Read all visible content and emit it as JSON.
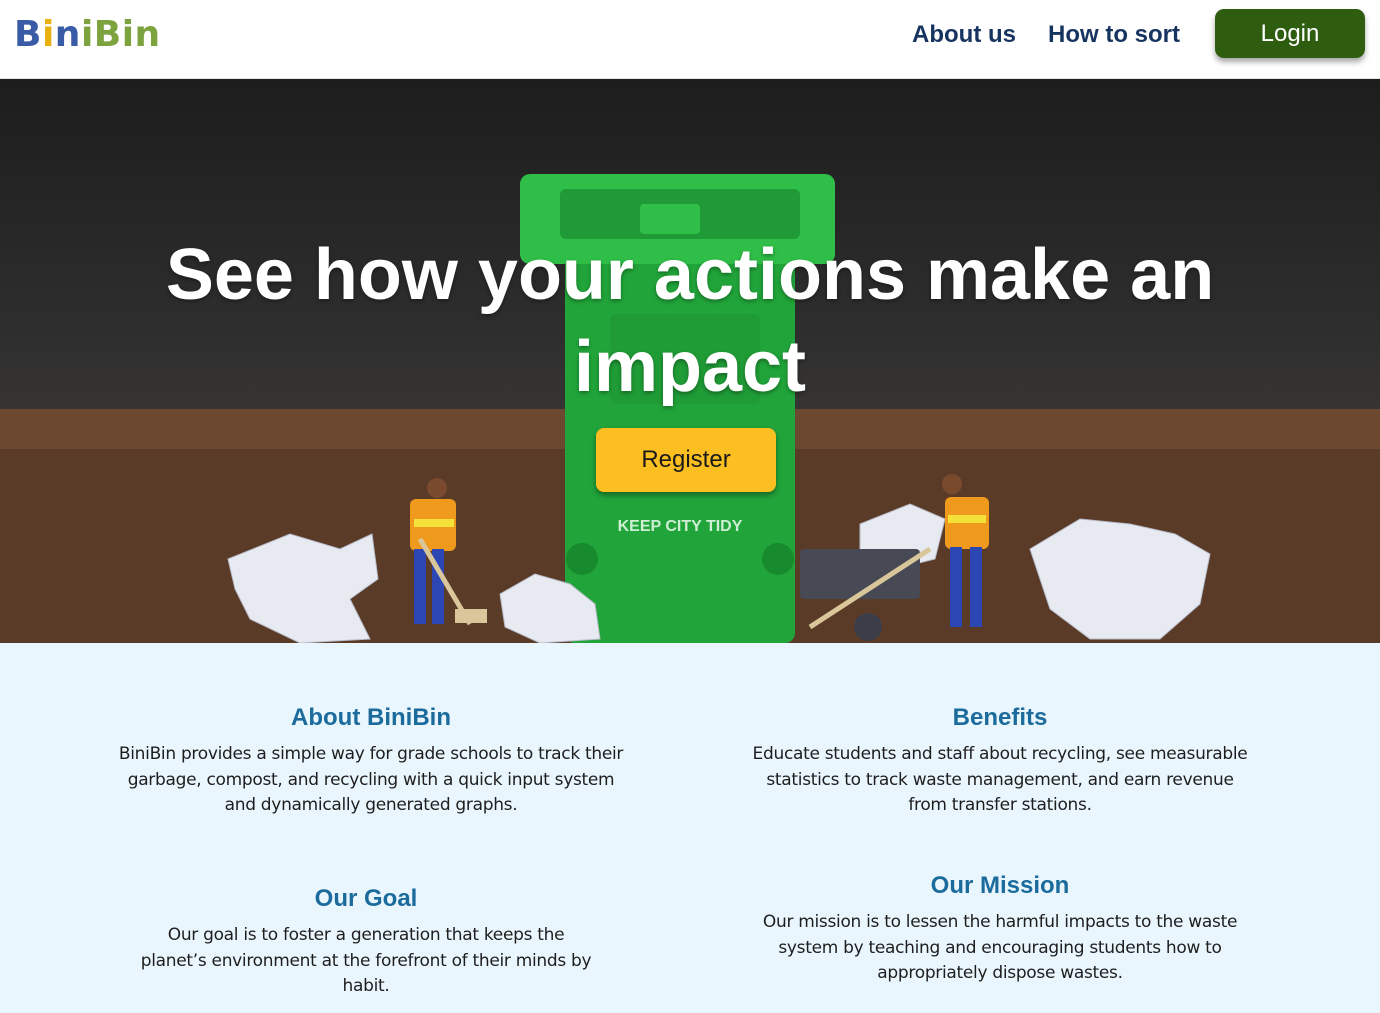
{
  "header": {
    "logo": {
      "parts": [
        "B",
        "i",
        "n",
        "i",
        "Bin"
      ],
      "colors": [
        "#3a5ca7",
        "#e8b10e",
        "#3a5ca7",
        "#7da33f",
        "#7da33f"
      ]
    },
    "nav": [
      {
        "label": "About us"
      },
      {
        "label": "How to sort"
      }
    ],
    "login_label": "Login"
  },
  "hero": {
    "title": "See how your actions make an impact",
    "register_label": "Register",
    "bin_text": "KEEP CITY TIDY"
  },
  "sections": {
    "about": {
      "heading": "About BiniBin",
      "body": "BiniBin provides a simple way for grade schools to track their garbage, compost, and recycling with a quick input system and dynamically generated graphs."
    },
    "benefits": {
      "heading": "Benefits",
      "body": "Educate students and staff about recycling, see measurable statistics to track waste management, and earn revenue from transfer stations."
    },
    "goal": {
      "heading": "Our Goal",
      "body": "Our goal is to foster a generation that keeps the planet’s environment at the forefront of their minds by habit."
    },
    "mission": {
      "heading": "Our Mission",
      "body": "Our mission is to lessen the harmful impacts to the waste system by teaching and encouraging students how to appropriately dispose wastes."
    }
  },
  "colors": {
    "nav_text": "#16345f",
    "login_bg": "#2f5d10",
    "register_bg": "#fcbf21",
    "heading": "#1b6b9c",
    "section_bg": "#eaf6fd"
  }
}
